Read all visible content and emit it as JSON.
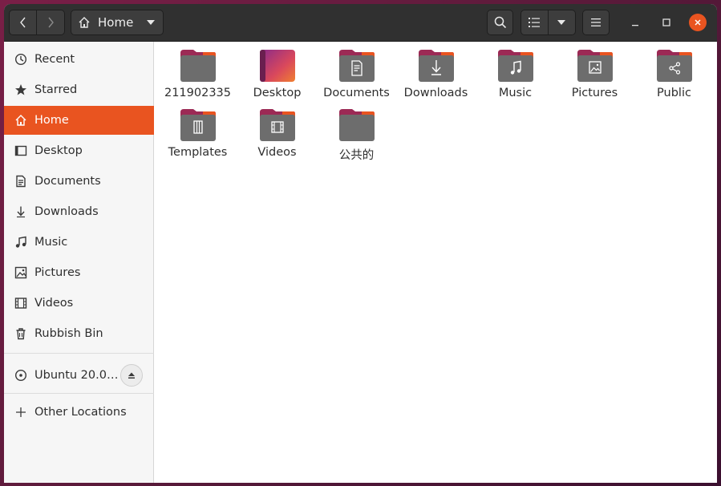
{
  "titlebar": {
    "path_label": "Home",
    "icons": {
      "back": "chevron-left-icon",
      "forward": "chevron-right-icon",
      "home": "home-icon",
      "path_menu": "caret-down-icon",
      "search": "search-icon",
      "view_list": "list-view-icon",
      "view_options": "caret-down-icon",
      "menu": "hamburger-menu-icon",
      "minimize": "minimize-icon",
      "maximize": "maximize-icon",
      "close": "close-icon"
    }
  },
  "sidebar": {
    "items": [
      {
        "label": "Recent",
        "icon": "clock-icon"
      },
      {
        "label": "Starred",
        "icon": "star-icon"
      },
      {
        "label": "Home",
        "icon": "home-icon",
        "active": true
      },
      {
        "label": "Desktop",
        "icon": "desktop-icon"
      },
      {
        "label": "Documents",
        "icon": "document-icon"
      },
      {
        "label": "Downloads",
        "icon": "download-icon"
      },
      {
        "label": "Music",
        "icon": "music-icon"
      },
      {
        "label": "Pictures",
        "icon": "picture-icon"
      },
      {
        "label": "Videos",
        "icon": "video-icon"
      },
      {
        "label": "Rubbish Bin",
        "icon": "trash-icon"
      }
    ],
    "devices": [
      {
        "label": "Ubuntu 20.0…",
        "icon": "disc-icon",
        "action_icon": "eject-icon"
      }
    ],
    "other": {
      "label": "Other Locations",
      "icon": "plus-icon"
    }
  },
  "content": {
    "items": [
      {
        "label": "211902335",
        "icon": "folder-icon"
      },
      {
        "label": "Desktop",
        "icon": "desktop-folder-icon"
      },
      {
        "label": "Documents",
        "icon": "documents-folder-icon"
      },
      {
        "label": "Downloads",
        "icon": "downloads-folder-icon"
      },
      {
        "label": "Music",
        "icon": "music-folder-icon"
      },
      {
        "label": "Pictures",
        "icon": "pictures-folder-icon"
      },
      {
        "label": "Public",
        "icon": "public-folder-icon"
      },
      {
        "label": "Templates",
        "icon": "templates-folder-icon"
      },
      {
        "label": "Videos",
        "icon": "videos-folder-icon"
      },
      {
        "label": "公共的",
        "icon": "folder-icon"
      }
    ]
  },
  "colors": {
    "accent": "#e95420",
    "titlebar": "#303030",
    "folder_tab": "#9c2a55",
    "folder_body": "#6d6d6d"
  }
}
